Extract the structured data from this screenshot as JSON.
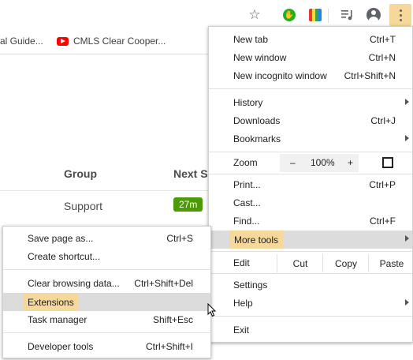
{
  "toolbar": {
    "icons": [
      "star-icon",
      "extension-green-icon",
      "extension-grid-icon",
      "media-queue-icon",
      "profile-icon",
      "kebab-menu-icon"
    ],
    "ext_green_glyph": "✋",
    "star_glyph": "☆"
  },
  "bookmarks": [
    {
      "label": "al Guide..."
    },
    {
      "label": "CMLS Clear Cooper..."
    }
  ],
  "page": {
    "columns": [
      "Group",
      "Next S"
    ],
    "row": {
      "group": "Support",
      "badge": "27m"
    }
  },
  "menu": {
    "items": [
      {
        "label": "New tab",
        "shortcut": "Ctrl+T"
      },
      {
        "label": "New window",
        "shortcut": "Ctrl+N"
      },
      {
        "label": "New incognito window",
        "shortcut": "Ctrl+Shift+N"
      },
      {
        "label": "History",
        "shortcut": ""
      },
      {
        "label": "Downloads",
        "shortcut": "Ctrl+J"
      },
      {
        "label": "Bookmarks",
        "shortcut": ""
      },
      {
        "label": "Print...",
        "shortcut": "Ctrl+P"
      },
      {
        "label": "Cast...",
        "shortcut": ""
      },
      {
        "label": "Find...",
        "shortcut": "Ctrl+F"
      },
      {
        "label": "More tools",
        "shortcut": ""
      },
      {
        "label": "Settings",
        "shortcut": ""
      },
      {
        "label": "Help",
        "shortcut": ""
      },
      {
        "label": "Exit",
        "shortcut": ""
      }
    ],
    "zoom": {
      "label": "Zoom",
      "minus": "–",
      "value": "100%",
      "plus": "+"
    },
    "edit": {
      "label": "Edit",
      "cut": "Cut",
      "copy": "Copy",
      "paste": "Paste"
    }
  },
  "submenu": {
    "items": [
      {
        "label": "Save page as...",
        "shortcut": "Ctrl+S"
      },
      {
        "label": "Create shortcut...",
        "shortcut": ""
      },
      {
        "label": "Clear browsing data...",
        "shortcut": "Ctrl+Shift+Del"
      },
      {
        "label": "Extensions",
        "shortcut": ""
      },
      {
        "label": "Task manager",
        "shortcut": "Shift+Esc"
      },
      {
        "label": "Developer tools",
        "shortcut": "Ctrl+Shift+I"
      }
    ]
  },
  "colors": {
    "highlight": "#f6d89a",
    "hover": "#dcdcdc",
    "badge": "#4c9a06"
  }
}
